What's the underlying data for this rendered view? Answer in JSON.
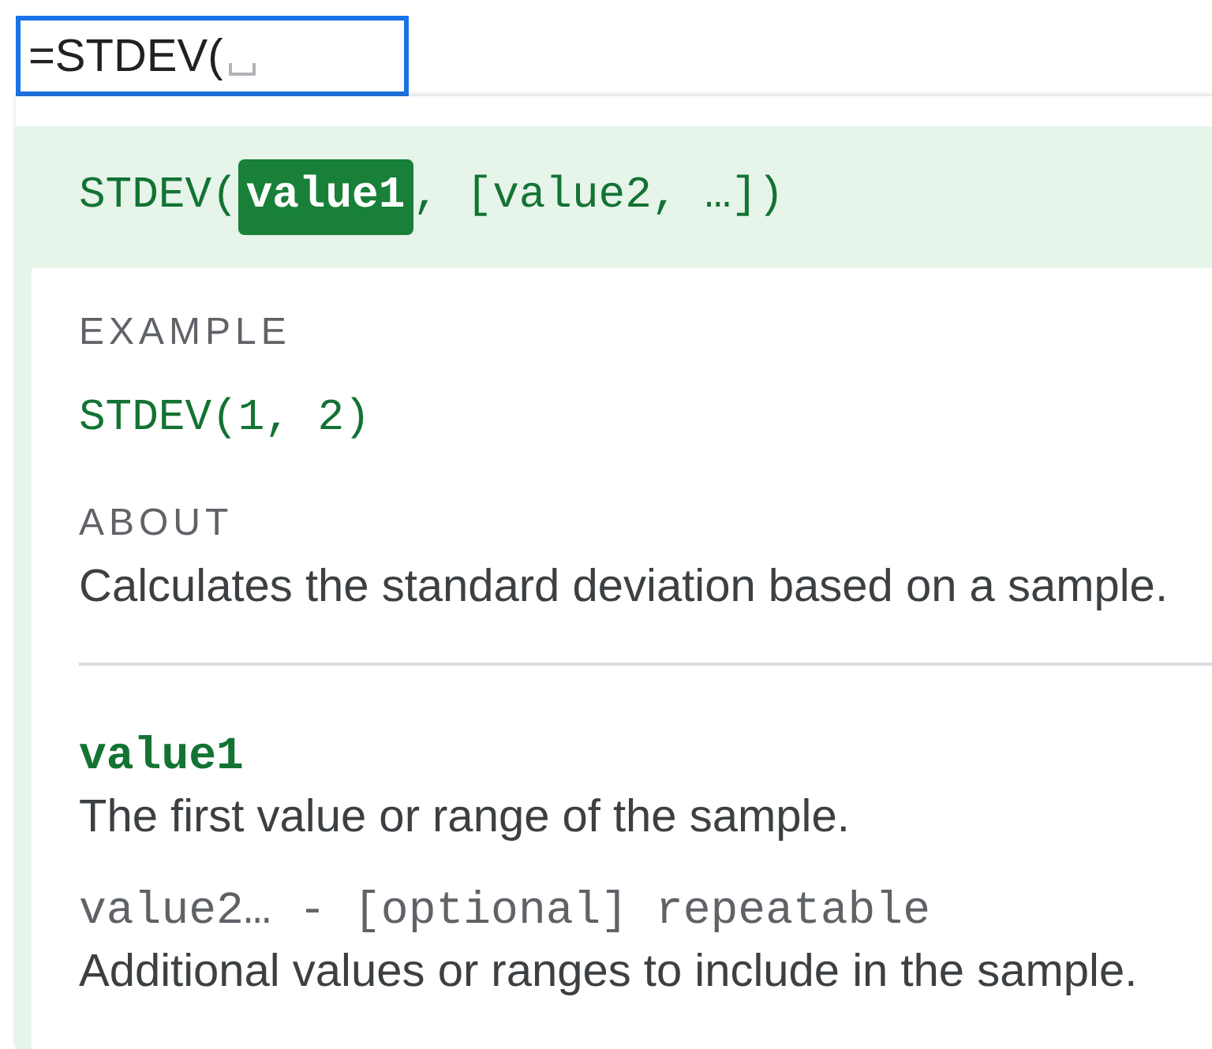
{
  "formula_bar": {
    "value": "=STDEV("
  },
  "signature": [
    {
      "text": "STDEV(",
      "selected": false
    },
    {
      "text": "value1",
      "selected": true
    },
    {
      "text": ", [value2, …])",
      "selected": false
    }
  ],
  "example": {
    "label": "EXAMPLE",
    "code": "STDEV(1, 2)"
  },
  "about": {
    "label": "ABOUT",
    "text": "Calculates the standard deviation based on a sample."
  },
  "arguments": [
    {
      "name": "value1",
      "selected": true,
      "description": "The first value or range of the sample."
    },
    {
      "name": "value2… - [optional] repeatable",
      "selected": false,
      "description": "Additional values or ranges to include in the sample."
    }
  ]
}
